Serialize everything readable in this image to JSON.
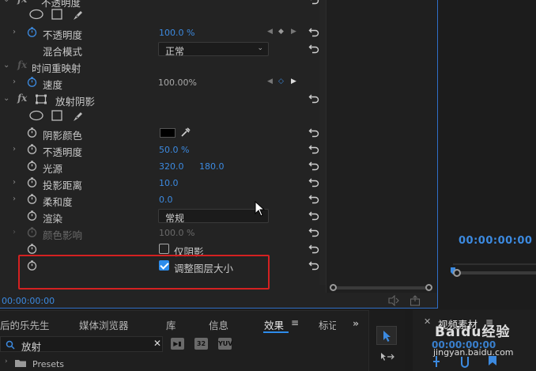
{
  "effect_controls": {
    "rows": {
      "opacity_header": "不透明度",
      "opacity": {
        "label": "不透明度",
        "value": "100.0 %"
      },
      "blend_mode": {
        "label": "混合模式",
        "value": "正常"
      },
      "time_remap": "时间重映射",
      "speed": {
        "label": "速度",
        "value": "100.00%"
      },
      "radial_shadow": "放射阴影",
      "shadow_color": {
        "label": "阴影颜色",
        "color": "#000000"
      },
      "shadow_opacity": {
        "label": "不透明度",
        "value": "50.0 %"
      },
      "light_source": {
        "label": "光源",
        "x": "320.0",
        "y": "180.0"
      },
      "projection_distance": {
        "label": "投影距离",
        "value": "10.0"
      },
      "softness": {
        "label": "柔和度",
        "value": "0.0"
      },
      "render": {
        "label": "渲染",
        "value": "常规"
      },
      "color_influence": {
        "label": "颜色影响",
        "value": "100.0 %"
      },
      "shadow_only": {
        "label": "仅阴影",
        "checked": false
      },
      "resize_layer": {
        "label": "调整图层大小",
        "checked": true
      }
    },
    "timecode": "00:00:00:00"
  },
  "program_monitor": {
    "timecode": "00:00:00:00"
  },
  "bottom_panel": {
    "tabs": [
      {
        "label": "后的乐先生"
      },
      {
        "label": "媒体浏览器"
      },
      {
        "label": "库"
      },
      {
        "label": "信息"
      },
      {
        "label": "效果"
      },
      {
        "label": "标记"
      }
    ],
    "active_tab": "效果",
    "search": {
      "query": "放射"
    },
    "filter_badges": [
      "32",
      "YUV"
    ],
    "tree": {
      "item": "Presets"
    }
  },
  "media_panel": {
    "title": "视频素材",
    "timecode": "00:00:00:00"
  },
  "watermark": {
    "line1": "Baidu经验",
    "line2": "jingyan.baidu.com"
  },
  "colors": {
    "accent": "#3c8ae0",
    "highlight_box": "#d42121",
    "panel_border": "#2f6ec7"
  }
}
